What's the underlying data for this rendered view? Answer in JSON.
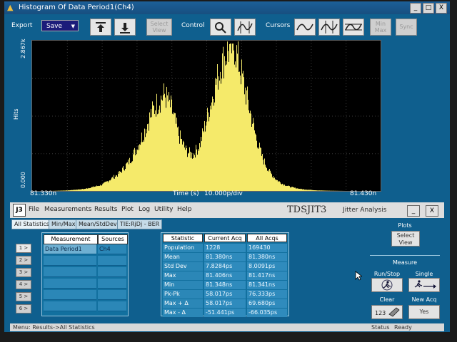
{
  "window": {
    "title": "Histogram Of Data Period1(Ch4)",
    "buttons": [
      "_",
      "□",
      "X"
    ]
  },
  "toolbar": {
    "export_label": "Export",
    "save_value": "Save",
    "select_view_label": "Select View",
    "control_label": "Control",
    "cursors_label": "Cursors",
    "minmax_label": "Min Max",
    "sync_label": "Sync"
  },
  "plot": {
    "y_max_label": "2.867k",
    "y_min_label": "0.000",
    "y_axis_label": "Hits",
    "x_left_label": "81.330n",
    "x_right_label": "81.430n",
    "x_axis_label": "Time (s)",
    "x_scale_label": "10.000p/div",
    "trace_color": "#f5ea6a",
    "grid_color": "#3a3a3a"
  },
  "chart_data": {
    "type": "area",
    "title": "Histogram Of Data Period1(Ch4)",
    "xlabel": "Time (s)",
    "ylabel": "Hits",
    "xlim": [
      81.33,
      81.43
    ],
    "ylim": [
      0,
      2867
    ],
    "x_units": "ns",
    "grid": true,
    "series": [
      {
        "x": [
          81.33,
          81.335,
          81.34,
          81.345,
          81.35,
          81.355,
          81.358,
          81.36,
          81.362,
          81.364,
          81.366,
          81.368,
          81.37,
          81.372,
          81.374,
          81.376,
          81.378,
          81.38,
          81.382,
          81.384,
          81.386,
          81.388,
          81.39,
          81.392,
          81.394,
          81.396,
          81.398,
          81.4,
          81.402,
          81.404,
          81.406,
          81.408,
          81.41,
          81.412,
          81.415,
          81.42,
          81.425,
          81.43
        ],
        "y": [
          0,
          0,
          10,
          40,
          120,
          350,
          600,
          850,
          1150,
          1500,
          1750,
          1900,
          1600,
          1100,
          800,
          700,
          900,
          1400,
          1950,
          2450,
          2750,
          2850,
          2300,
          1700,
          1100,
          650,
          380,
          220,
          130,
          80,
          50,
          30,
          20,
          10,
          5,
          0,
          0,
          0
        ]
      }
    ]
  },
  "j3": {
    "logo": "J3",
    "menu": [
      "File",
      "Measurements",
      "Results",
      "Plot",
      "Log",
      "Utility",
      "Help"
    ],
    "app_title": "TDSJIT3",
    "app_subtitle": "Jitter Analysis",
    "min_btn": "_",
    "close_btn": "X"
  },
  "tabs": [
    "All Statistics",
    "Min/Max",
    "Mean/StdDev",
    "TIE:RjDj - BER"
  ],
  "side_buttons": [
    "1 >",
    "2 >",
    "3 >",
    "4 >",
    "5 >",
    "6 >"
  ],
  "measurements": {
    "headers": [
      "Measurement",
      "Sources"
    ],
    "rows": [
      {
        "measurement": "Data Period1",
        "source": "Ch4"
      }
    ]
  },
  "statistics": {
    "headers": [
      "Statistic",
      "Current Acq",
      "All Acqs"
    ],
    "rows": [
      {
        "stat": "Population",
        "current": "1228",
        "all": "169430"
      },
      {
        "stat": "Mean",
        "current": "81.380ns",
        "all": "81.380ns"
      },
      {
        "stat": "Std Dev",
        "current": "7.8284ps",
        "all": "8.0091ps"
      },
      {
        "stat": "Max",
        "current": "81.406ns",
        "all": "81.417ns"
      },
      {
        "stat": "Min",
        "current": "81.348ns",
        "all": "81.341ns"
      },
      {
        "stat": "Pk-Pk",
        "current": "58.017ps",
        "all": "76.333ps"
      },
      {
        "stat": "Max + Δ",
        "current": "58.017ps",
        "all": "69.680ps"
      },
      {
        "stat": "Max - Δ",
        "current": "-51.441ps",
        "all": "-66.035ps"
      }
    ]
  },
  "controls": {
    "plots_label": "Plots",
    "select_view_label": "Select View",
    "measure_label": "Measure",
    "run_stop_label": "Run/Stop",
    "single_label": "Single",
    "clear_label": "Clear",
    "new_acq_label": "New Acq",
    "yes_label": "Yes"
  },
  "status": {
    "menu_path": "Menu: Results->All Statistics",
    "status_label": "Status",
    "status_value": "Ready"
  }
}
